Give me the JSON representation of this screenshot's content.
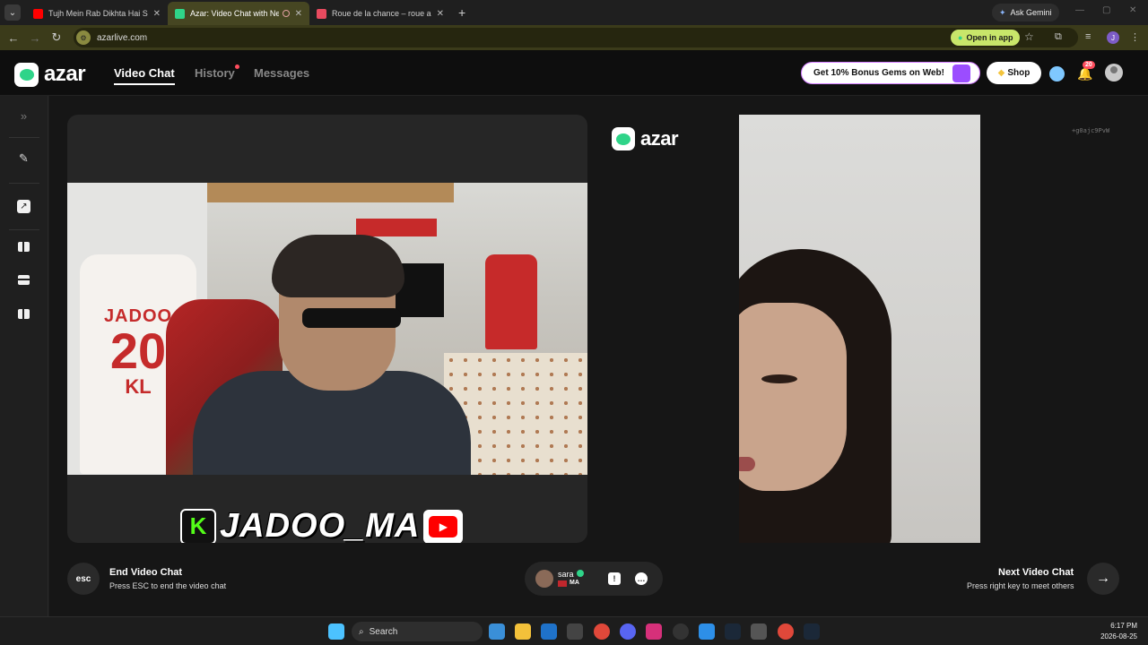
{
  "browser": {
    "tabs": [
      {
        "title": "Tujh Mein Rab Dikhta Hai Song",
        "favicon_color": "#ff0000"
      },
      {
        "title": "Azar: Video Chat with New",
        "favicon_color": "#2fd489"
      },
      {
        "title": "Roue de la chance – roue aléatoire",
        "favicon_color": "#e84a5f"
      }
    ],
    "ask_gemini": "Ask Gemini",
    "url": "azarlive.com",
    "open_in_app": "Open in app",
    "profile_initial": "J"
  },
  "header": {
    "logo_text": "azar",
    "nav": [
      {
        "label": "Video Chat"
      },
      {
        "label": "History"
      },
      {
        "label": "Messages"
      }
    ],
    "promo": "Get 10% Bonus Gems on Web!",
    "shop": "Shop",
    "notification_count": "20"
  },
  "stream": {
    "jersey_name": "JADOO",
    "jersey_number": "20",
    "jersey_initials": "KL",
    "kick_glyph": "K",
    "handle": "JADOO_MA",
    "yt_glyph": "▶"
  },
  "center_logo": "azar",
  "remote_id": "+g0ajc9PvW",
  "controls": {
    "esc_label": "esc",
    "end_title": "End Video Chat",
    "end_sub": "Press ESC to end the video chat",
    "peer_name": "sara",
    "peer_country": "MA",
    "next_title": "Next Video Chat",
    "next_sub": "Press right key to meet others"
  },
  "taskbar": {
    "search": "Search",
    "time": "6:17 PM",
    "date": "2026-08-25"
  },
  "colors": {
    "accent": "#2fd489",
    "notification": "#ff4d5e",
    "open_in_app_bg": "#c8e66a"
  }
}
